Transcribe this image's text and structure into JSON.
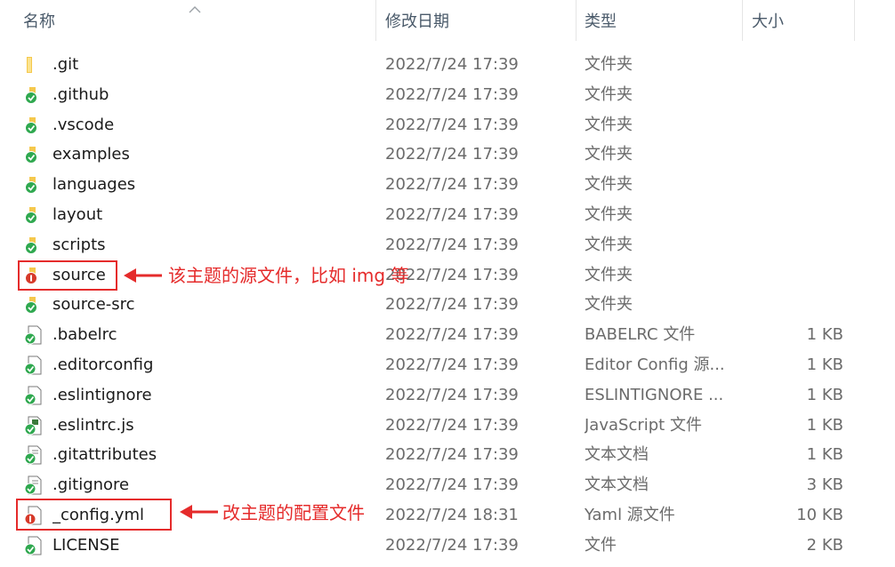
{
  "header": {
    "name": "名称",
    "date": "修改日期",
    "type": "类型",
    "size": "大小"
  },
  "colors": {
    "annotation": "#e52b2b",
    "folder_yellow": "#f5c84c",
    "git_green": "#2fa84f",
    "source_red": "#d63a2a"
  },
  "files": [
    {
      "name": ".git",
      "date": "2022/7/24 17:39",
      "type": "文件夹",
      "size": "",
      "icon": "folder-icon"
    },
    {
      "name": ".github",
      "date": "2022/7/24 17:39",
      "type": "文件夹",
      "size": "",
      "icon": "folder-git-green-icon"
    },
    {
      "name": ".vscode",
      "date": "2022/7/24 17:39",
      "type": "文件夹",
      "size": "",
      "icon": "folder-git-green-icon"
    },
    {
      "name": "examples",
      "date": "2022/7/24 17:39",
      "type": "文件夹",
      "size": "",
      "icon": "folder-git-green-icon"
    },
    {
      "name": "languages",
      "date": "2022/7/24 17:39",
      "type": "文件夹",
      "size": "",
      "icon": "folder-git-green-icon"
    },
    {
      "name": "layout",
      "date": "2022/7/24 17:39",
      "type": "文件夹",
      "size": "",
      "icon": "folder-git-green-icon"
    },
    {
      "name": "scripts",
      "date": "2022/7/24 17:39",
      "type": "文件夹",
      "size": "",
      "icon": "folder-git-green-icon"
    },
    {
      "name": "source",
      "date": "2022/7/24 17:39",
      "type": "文件夹",
      "size": "",
      "icon": "folder-git-red-icon"
    },
    {
      "name": "source-src",
      "date": "2022/7/24 17:39",
      "type": "文件夹",
      "size": "",
      "icon": "folder-git-green-icon"
    },
    {
      "name": ".babelrc",
      "date": "2022/7/24 17:39",
      "type": "BABELRC 文件",
      "size": "1 KB",
      "icon": "file-git-green-icon"
    },
    {
      "name": ".editorconfig",
      "date": "2022/7/24 17:39",
      "type": "Editor Config 源...",
      "size": "1 KB",
      "icon": "file-git-green-icon"
    },
    {
      "name": ".eslintignore",
      "date": "2022/7/24 17:39",
      "type": "ESLINTIGNORE ...",
      "size": "1 KB",
      "icon": "file-git-green-icon"
    },
    {
      "name": ".eslintrc.js",
      "date": "2022/7/24 17:39",
      "type": "JavaScript 文件",
      "size": "1 KB",
      "icon": "file-js-git-green-icon"
    },
    {
      "name": ".gitattributes",
      "date": "2022/7/24 17:39",
      "type": "文本文档",
      "size": "1 KB",
      "icon": "file-text-git-green-icon"
    },
    {
      "name": ".gitignore",
      "date": "2022/7/24 17:39",
      "type": "文本文档",
      "size": "3 KB",
      "icon": "file-text-git-green-icon"
    },
    {
      "name": "_config.yml",
      "date": "2022/7/24 18:31",
      "type": "Yaml 源文件",
      "size": "10 KB",
      "icon": "file-git-red-icon"
    },
    {
      "name": "LICENSE",
      "date": "2022/7/24 17:39",
      "type": "文件",
      "size": "2 KB",
      "icon": "file-git-green-icon"
    }
  ],
  "annotations": {
    "source_note": "该主题的源文件，比如 img 等",
    "config_note": "改主题的配置文件"
  }
}
